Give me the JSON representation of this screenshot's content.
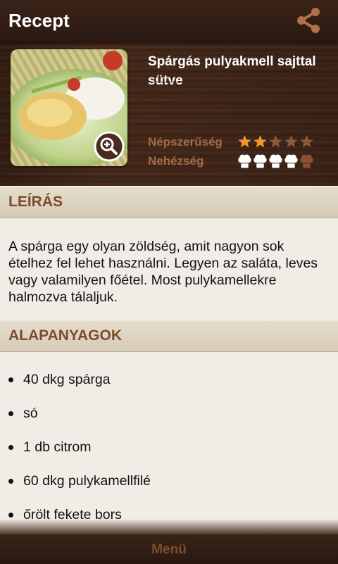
{
  "appbar": {
    "title": "Recept",
    "share_icon": "share-icon"
  },
  "recipe": {
    "title": "Spárgás pulyakmell sajttal sütve",
    "popularity_label": "Népszerűség",
    "popularity": 2,
    "popularity_max": 5,
    "difficulty_label": "Nehézség",
    "difficulty": 4,
    "difficulty_max": 5
  },
  "description": {
    "heading": "LEÍRÁS",
    "text": "A spárga egy olyan zöldség, amit nagyon sok ételhez fel lehet használni. Legyen az saláta, leves vagy valamilyen főétel. Most pulykamellekre halmozva tálaljuk."
  },
  "ingredients": {
    "heading": "ALAPANYAGOK",
    "items": [
      "40 dkg spárga",
      "só",
      "1 db citrom",
      "60 dkg pulykamellfilé",
      "őrölt fekete bors"
    ]
  },
  "bottom": {
    "menu_label": "Menü"
  },
  "colors": {
    "star_on": "#f0962c",
    "star_off": "#8a5a3c",
    "hat_on": "#ffffff",
    "hat_off": "#8c4f33",
    "accent": "#7a4b2d"
  }
}
